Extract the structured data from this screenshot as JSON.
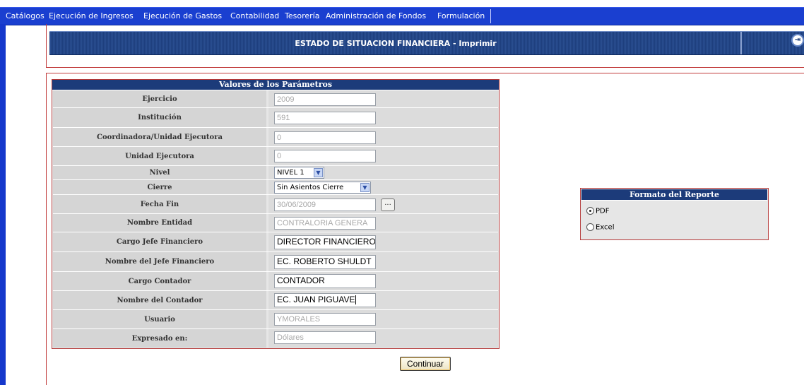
{
  "menu": [
    "Catálogos",
    "Ejecución de Ingresos",
    "Ejecución de Gastos",
    "Contabilidad",
    "Tesorería",
    "Administración de Fondos",
    "Formulación"
  ],
  "header": {
    "title": "ESTADO DE SITUACION FINANCIERA - Imprimir"
  },
  "params": {
    "title": "Valores de los Parámetros",
    "fields": [
      {
        "label": "Ejercicio",
        "value": "2009",
        "type": "text",
        "enabled": false
      },
      {
        "label": "Institución",
        "value": "591",
        "type": "text",
        "enabled": false
      },
      {
        "label": "Coordinadora/Unidad Ejecutora",
        "value": "0",
        "type": "text",
        "enabled": false
      },
      {
        "label": "Unidad Ejecutora",
        "value": "0",
        "type": "text",
        "enabled": false
      },
      {
        "label": "Nivel",
        "value": "NIVEL 1",
        "type": "select"
      },
      {
        "label": "Cierre",
        "value": "Sin Asientos Cierre",
        "type": "select"
      },
      {
        "label": "Fecha Fin",
        "value": "30/06/2009",
        "type": "date",
        "enabled": false,
        "button_label": "..."
      },
      {
        "label": "Nombre Entidad",
        "value": "CONTRALORIA GENERA",
        "type": "text",
        "enabled": false
      },
      {
        "label": "Cargo Jefe Financiero",
        "value": "DIRECTOR FINANCIERO",
        "type": "text",
        "enabled": true
      },
      {
        "label": "Nombre del Jefe Financiero",
        "value": "EC. ROBERTO SHULDT",
        "type": "text",
        "enabled": true
      },
      {
        "label": "Cargo Contador",
        "value": "CONTADOR",
        "type": "text",
        "enabled": true
      },
      {
        "label": "Nombre del Contador",
        "value": "EC. JUAN PIGUAVE",
        "type": "text",
        "enabled": true,
        "focused": true
      },
      {
        "label": "Usuario",
        "value": "YMORALES",
        "type": "text",
        "enabled": false
      },
      {
        "label": "Expresado en:",
        "value": "Dólares",
        "type": "text",
        "enabled": false
      }
    ]
  },
  "format": {
    "title": "Formato del Reporte",
    "options": [
      {
        "label": "PDF",
        "selected": true
      },
      {
        "label": "Excel",
        "selected": false
      }
    ]
  },
  "continue_label": "Continuar",
  "icons": {
    "exit": "exit-door-icon",
    "dropdown": "chevron-down-icon"
  },
  "colors": {
    "menu_bg": "#1a3fd0",
    "header_bg": "#1e3f7e",
    "panel_border": "#b53838"
  }
}
